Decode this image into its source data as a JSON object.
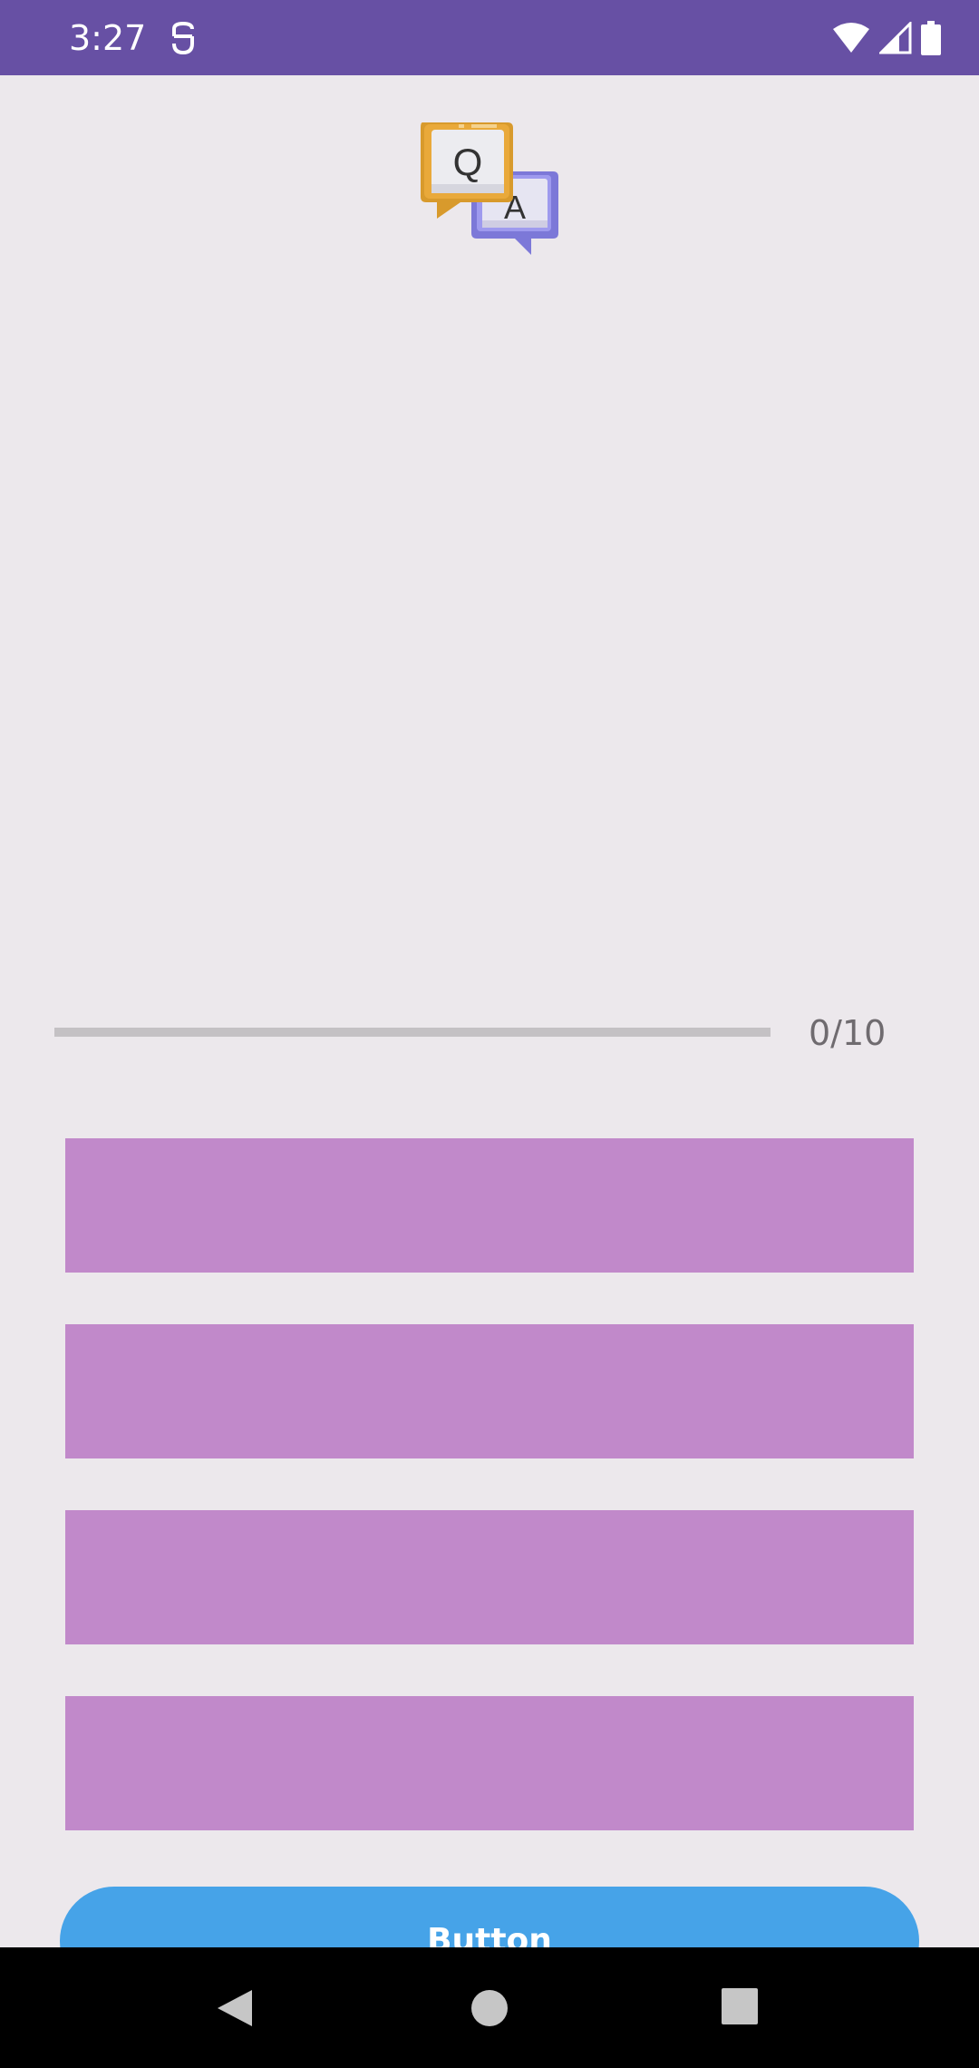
{
  "status_bar": {
    "time": "3:27",
    "background": "#6750A4",
    "icons": [
      "notification-app-icon",
      "wifi-icon",
      "cell-signal-icon",
      "battery-icon"
    ]
  },
  "logo": {
    "question_letter": "Q",
    "answer_letter": "A",
    "question_color": "#E9A93A",
    "answer_color": "#8B86E0"
  },
  "progress": {
    "label": "0/10",
    "current": 0,
    "max": 10
  },
  "options": [
    "",
    "",
    "",
    ""
  ],
  "option_color": "#C189CA",
  "primary_button": {
    "label": "Button",
    "color": "#46A3E8"
  },
  "nav_bar": {
    "icons": [
      "back-icon",
      "home-icon",
      "recents-icon"
    ]
  }
}
